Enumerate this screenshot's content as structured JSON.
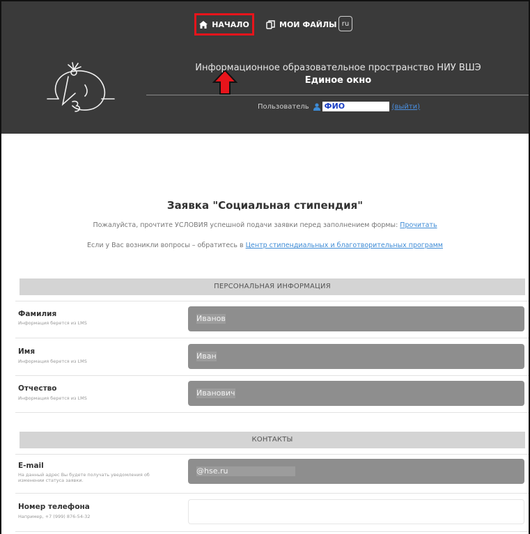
{
  "nav": {
    "home_label": "НАЧАЛО",
    "files_label": "МОИ ФАЙЛЫ",
    "lang_label": "ru"
  },
  "header": {
    "title": "Информационное образовательное пространство НИУ ВШЭ",
    "subtitle": "Единое окно",
    "user_prefix": "Пользователь",
    "user_name": "ФИО",
    "logout_label": "(выйти)"
  },
  "form": {
    "title": "Заявка \"Социальная стипендия\"",
    "info1_text": "Пожалуйста, прочтите УСЛОВИЯ успешной подачи заявки перед заполнением формы: ",
    "info1_link": "Прочитать",
    "info2_text": "Если у Вас возникли вопросы – обратитесь в ",
    "info2_link": "Центр стипендиальных и благотворительных программ"
  },
  "sections": {
    "personal": "ПЕРСОНАЛЬНАЯ ИНФОРМАЦИЯ",
    "contacts": "КОНТАКТЫ"
  },
  "fields": {
    "surname": {
      "label": "Фамилия",
      "hint": "Информация берется из LMS",
      "value": "Иванов"
    },
    "name": {
      "label": "Имя",
      "hint": "Информация берется из LMS",
      "value": "Иван"
    },
    "patronymic": {
      "label": "Отчество",
      "hint": "Информация берется из LMS",
      "value": "Иванович"
    },
    "email": {
      "label": "E-mail",
      "hint": "На данный адрес Вы будете получать уведомления об изменении статуса заявки.",
      "value": "@hse.ru"
    },
    "phone": {
      "label": "Номер телефона",
      "hint": "Например, +7 (999) 876-54-32",
      "value": ""
    }
  },
  "colors": {
    "header_bg": "#3a3a3a",
    "highlight": "#e8141b",
    "link": "#3d8bd6",
    "section_bg": "#d4d4d4",
    "input_bg": "#8e8e8e"
  },
  "icons": {
    "home": "home-icon",
    "files": "files-icon",
    "user": "user-icon",
    "arrow": "up-arrow-icon",
    "logo": "hse-logo"
  }
}
